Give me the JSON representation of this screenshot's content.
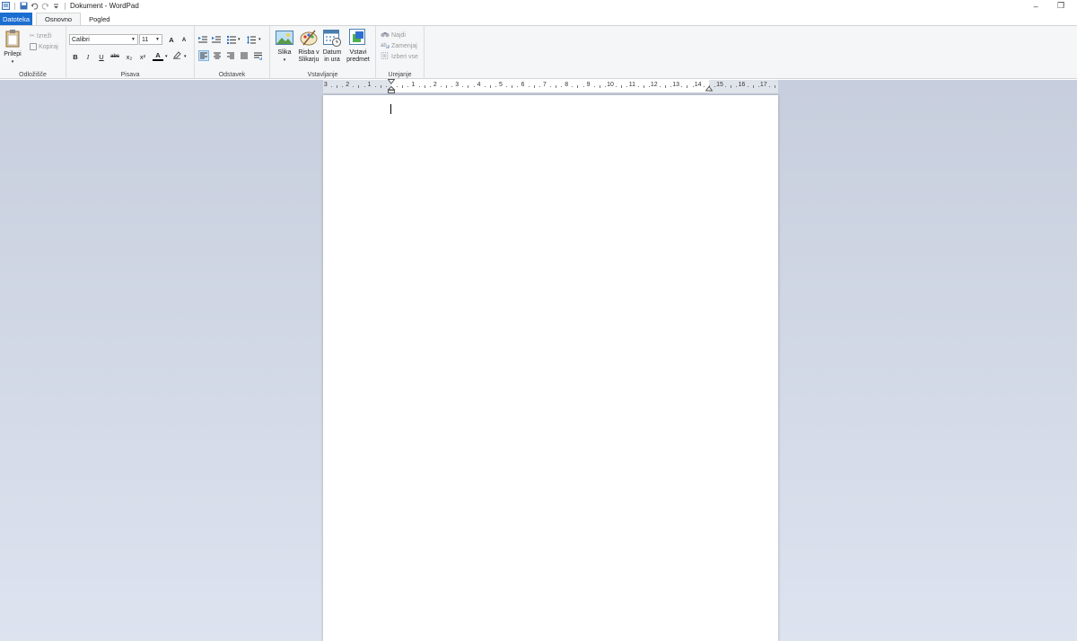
{
  "window": {
    "title": "Dokument - WordPad",
    "minimize_glyph": "–",
    "restore_glyph": "❒"
  },
  "quick_access": {
    "icons": [
      "wordpad-app-icon",
      "save-icon",
      "undo-icon",
      "redo-icon",
      "customize-dropdown-icon"
    ]
  },
  "tabs": [
    "Datoteka",
    "Osnovno",
    "Pogled"
  ],
  "clipboard": {
    "label": "Odložišče",
    "paste": "Prilepi",
    "cut": "Izreži",
    "copy": "Kopiraj"
  },
  "font": {
    "label": "Pisava",
    "family": "Calibri",
    "size": "11",
    "grow": "A",
    "shrink": "A",
    "bold": "B",
    "italic": "I",
    "underline": "U",
    "strike": "abc",
    "subscript": "x₂",
    "superscript": "x²",
    "color": "A"
  },
  "paragraph": {
    "label": "Odstavek"
  },
  "insert": {
    "label": "Vstavljanje",
    "picture": "Slika",
    "paint_line1": "Risba v",
    "paint_line2": "Slikarju",
    "datetime_line1": "Datum",
    "datetime_line2": "in ura",
    "object_line1": "Vstavi",
    "object_line2": "predmet"
  },
  "editing": {
    "label": "Urejanje",
    "find": "Najdi",
    "replace": "Zamenjaj",
    "select_all": "Izberi vse"
  },
  "ruler": {
    "numbers": [
      "3",
      "2",
      "1",
      "1",
      "2",
      "3",
      "4",
      "5",
      "6",
      "7",
      "8",
      "9",
      "10",
      "11",
      "12",
      "13",
      "14",
      "15",
      "16",
      "17"
    ]
  },
  "colors": {
    "accent": "#1a6dd1",
    "ribbon_bg": "#f5f6f7",
    "workspace_top": "#c7cedd",
    "workspace_bottom": "#dde3ef"
  }
}
